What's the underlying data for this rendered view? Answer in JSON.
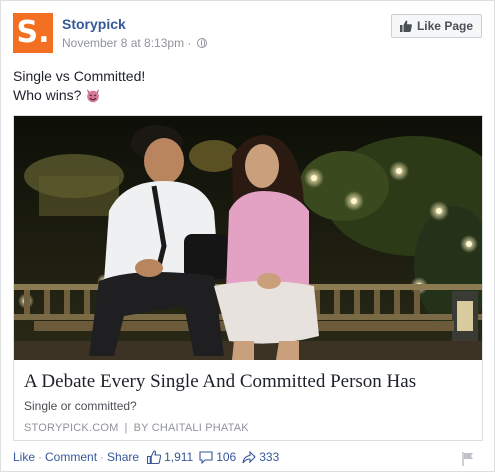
{
  "post": {
    "page_name": "Storypick",
    "timestamp": "November 8 at 8:13pm",
    "privacy_separator": "·",
    "avatar_letter": "S.",
    "avatar_color": "#f36f21",
    "like_page_label": "Like Page",
    "text_line1": "Single vs Committed!",
    "text_line2": "Who wins?",
    "emoji_icon": "devil-face-icon"
  },
  "attachment": {
    "title": "A Debate Every Single And Committed Person Has",
    "description": "Single or committed?",
    "source": "STORYPICK.COM",
    "separator": "|",
    "author": "BY CHAITALI PHATAK"
  },
  "actions": {
    "like": "Like",
    "comment": "Comment",
    "share": "Share",
    "dot": "·",
    "likes_count": "1,911",
    "comments_count": "106",
    "shares_count": "333"
  },
  "colors": {
    "link": "#365899",
    "muted": "#90949c",
    "text": "#1d2129"
  }
}
